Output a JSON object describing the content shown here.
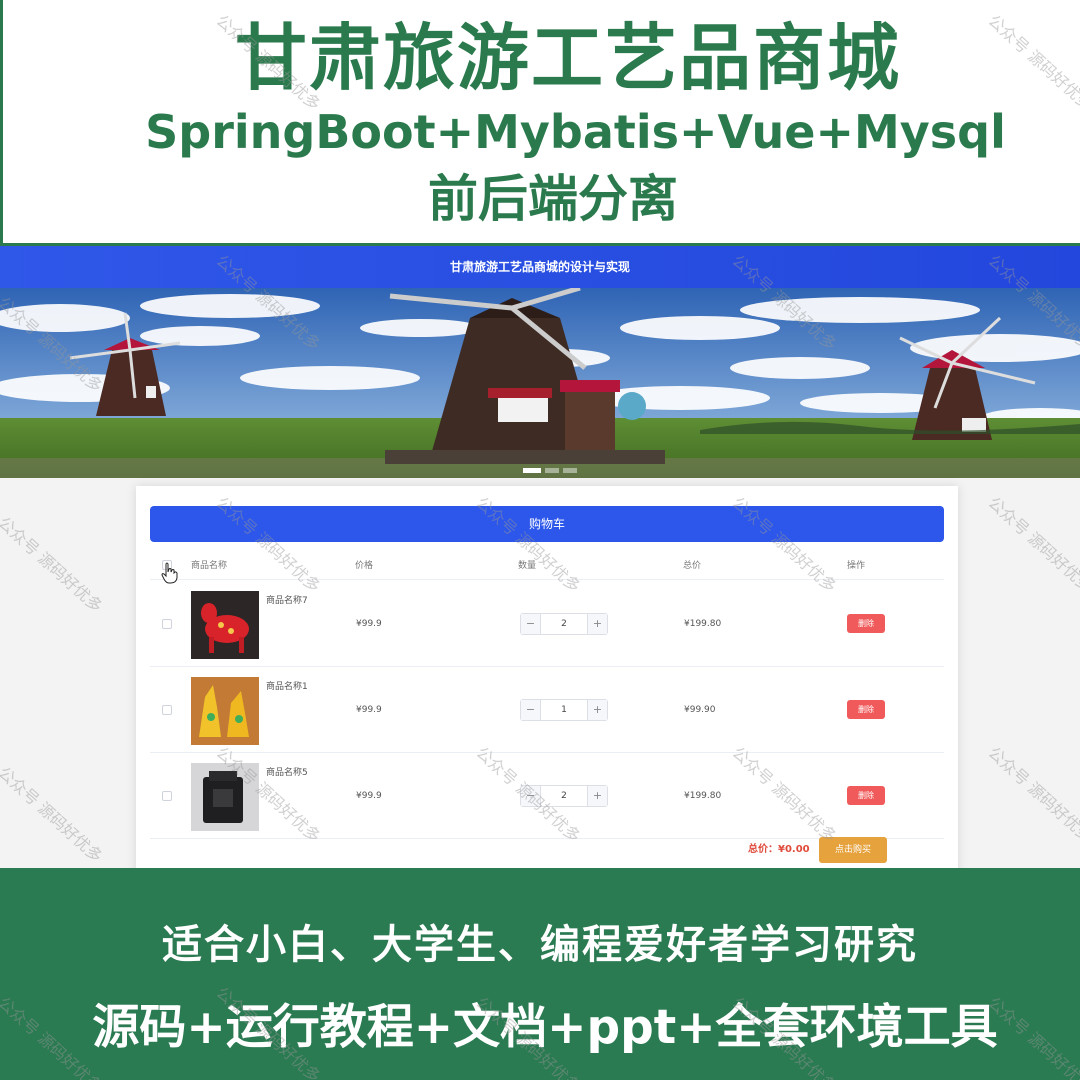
{
  "promo_top": {
    "title": "甘肃旅游工艺品商城",
    "tech_stack": "SpringBoot+Mybatis+Vue+Mysql",
    "architecture": "前后端分离"
  },
  "app": {
    "header_title": "甘肃旅游工艺品商城的设计与实现",
    "carousel": {
      "slide_count": 3,
      "active_index": 0
    },
    "cart": {
      "title": "购物车",
      "columns": [
        "商品名称",
        "价格",
        "数量",
        "总价",
        "操作"
      ],
      "items": [
        {
          "name": "商品名称7",
          "price": "¥99.9",
          "quantity": "2",
          "subtotal": "¥199.80",
          "delete_label": "删除",
          "minus": "−",
          "plus": "+"
        },
        {
          "name": "商品名称1",
          "price": "¥99.9",
          "quantity": "1",
          "subtotal": "¥99.90",
          "delete_label": "删除",
          "minus": "−",
          "plus": "+"
        },
        {
          "name": "商品名称5",
          "price": "¥99.9",
          "quantity": "2",
          "subtotal": "¥199.80",
          "delete_label": "删除",
          "minus": "−",
          "plus": "+"
        }
      ],
      "total_label": "总价：¥0.00",
      "buy_label": "点击购买"
    }
  },
  "promo_bottom": {
    "line1": "适合小白、大学生、编程爱好者学习研究",
    "line2": "源码+运行教程+文档+ppt+全套环境工具"
  },
  "watermark": "公众号 源码好优多",
  "colors": {
    "brand_green": "#2a7a4d",
    "header_blue": "#2f57e8",
    "delete_red": "#f05a5a",
    "buy_orange": "#e6a23c",
    "total_red": "#e04a3a"
  }
}
